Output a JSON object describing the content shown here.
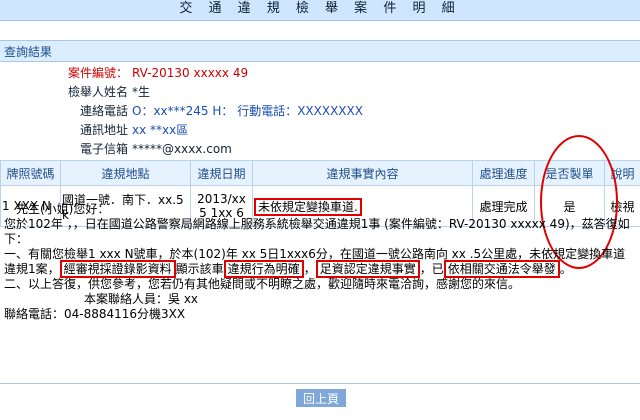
{
  "page": {
    "title": "交 通 違 規 檢 舉 案 件 明 細"
  },
  "query": {
    "section_title": "查詢結果",
    "case_no_label": "案件編號：",
    "case_no_value": "RV-20130 xxxxx 49",
    "reporter_name_label": "檢舉人姓名",
    "reporter_name_value": "*生",
    "phone_label": "連絡電話",
    "phone_value": "O：xx***245 H： 行動電話：XXXXXXXX",
    "address_label": "通訊地址",
    "address_value": "xx **xx區",
    "email_label": "電子信箱",
    "email_value": "*****@xxxx.com"
  },
  "table": {
    "headers": [
      "牌照號碼",
      "違規地點",
      "違規日期",
      "違規事實內容",
      "處理進度",
      "是否製單",
      "說明"
    ],
    "rows": [
      {
        "plate": "1 XXX N",
        "location": "國道一號．南下．xx.5 k",
        "date": "2013/xx 5 1xx 6",
        "violation": "未依規定變換車道.",
        "status": "處理完成",
        "ticket_issued": "是",
        "note": "檢視"
      }
    ]
  },
  "reply": {
    "greeting": "先生(小姐)您好：",
    "para1": "您於102年 ，，日在國道公路警察局網路線上服務系統檢舉交通違規1事 (案件編號：RV-20130 xxxxx 49)，茲答復如下：",
    "para2_a": "一、有關您檢舉1 xxx N號車，於本(102)年 xx 5日1xxx6分，在國道一號公路南向 xx .5公里處，未依規定變換車道違規1案，",
    "para2_hl1": "經審視採證錄影資料",
    "para2_b": "顯示該車",
    "para2_hl2": "違規行為明確",
    "para2_c": "，",
    "para2_hl3": "足資認定違規事實",
    "para2_d": "，已",
    "para2_hl4": "依相關交通法令舉發",
    "para2_e": "。",
    "para3": "二、以上答復，供您參考，您若仍有其他疑問或不明瞭之處，歡迎隨時來電洽詢，感謝您的來信。",
    "contact_person": "本案聯絡人員：吳 xx",
    "contact_phone": "聯絡電話：04-8884116分機3XX"
  },
  "actions": {
    "back_label": "回上頁"
  },
  "colors": {
    "highlight": "#e00000",
    "label_blue": "#1f4f8a",
    "section_bg": "#dbeeff"
  }
}
